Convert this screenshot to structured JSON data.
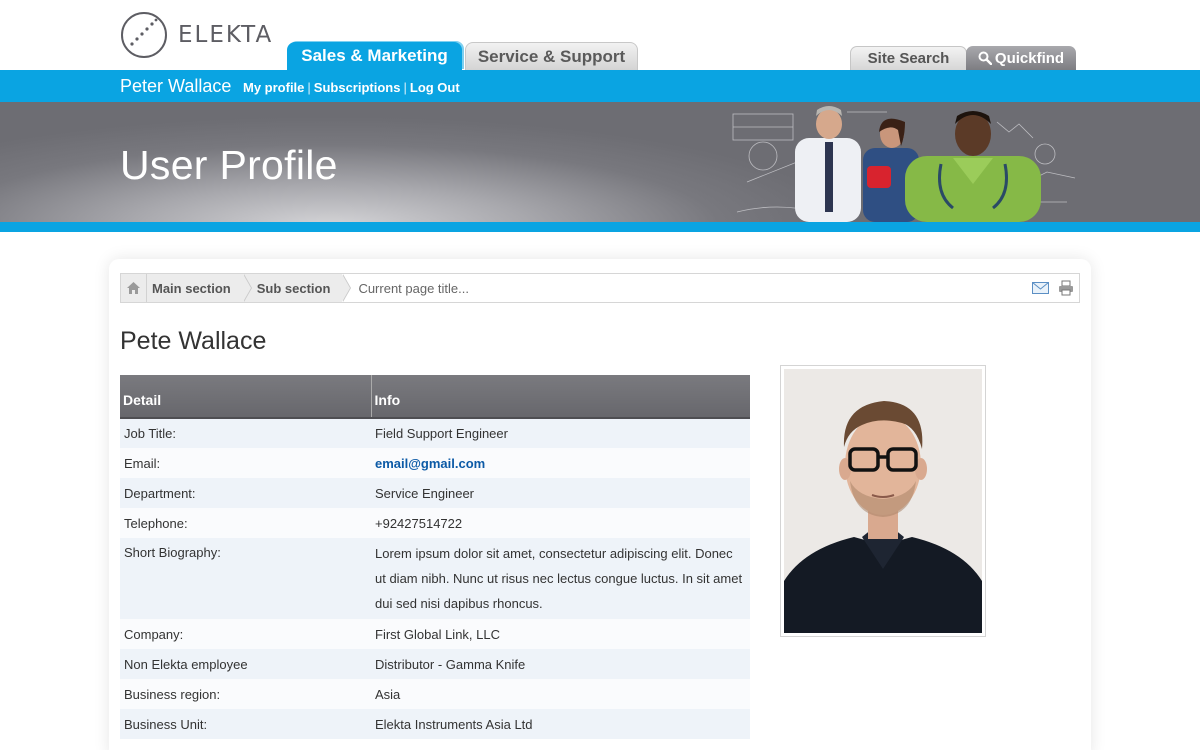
{
  "brand": {
    "logo_text": "ELEKTA",
    "accent": "#0aa4e2"
  },
  "nav": {
    "tabs": [
      {
        "label": "Sales & Marketing",
        "active": true
      },
      {
        "label": "Service & Support",
        "active": false
      }
    ],
    "site_search_label": "Site Search",
    "quickfind_label": "Quickfind"
  },
  "user": {
    "name": "Peter Wallace",
    "links": [
      "My profile",
      "Subscriptions",
      "Log Out"
    ],
    "separator": "|"
  },
  "banner": {
    "title": "User Profile"
  },
  "breadcrumb": {
    "items": [
      "Main section",
      "Sub section"
    ],
    "current": "Current page title..."
  },
  "profile": {
    "name": "Pete Wallace",
    "table": {
      "headers": [
        "Detail",
        "Info"
      ],
      "rows": [
        {
          "label": "Job Title:",
          "value": "Field Support Engineer"
        },
        {
          "label": "Email:",
          "value": "email@gmail.com"
        },
        {
          "label": "Department:",
          "value": "Service Engineer"
        },
        {
          "label": "Telephone:",
          "value": "+92427514722"
        },
        {
          "label": "Short Biography:",
          "value": "Lorem ipsum dolor sit amet, consectetur adipiscing elit. Donec ut diam nibh. Nunc ut risus nec lectus congue luctus. In sit amet dui sed nisi dapibus rhoncus."
        },
        {
          "label": "Company:",
          "value": "First Global Link, LLC"
        },
        {
          "label": "Non Elekta employee",
          "value": "Distributor - Gamma Knife"
        },
        {
          "label": "Business region:",
          "value": "Asia"
        },
        {
          "label": "Business Unit:",
          "value": "Elekta Instruments Asia Ltd"
        }
      ]
    }
  }
}
